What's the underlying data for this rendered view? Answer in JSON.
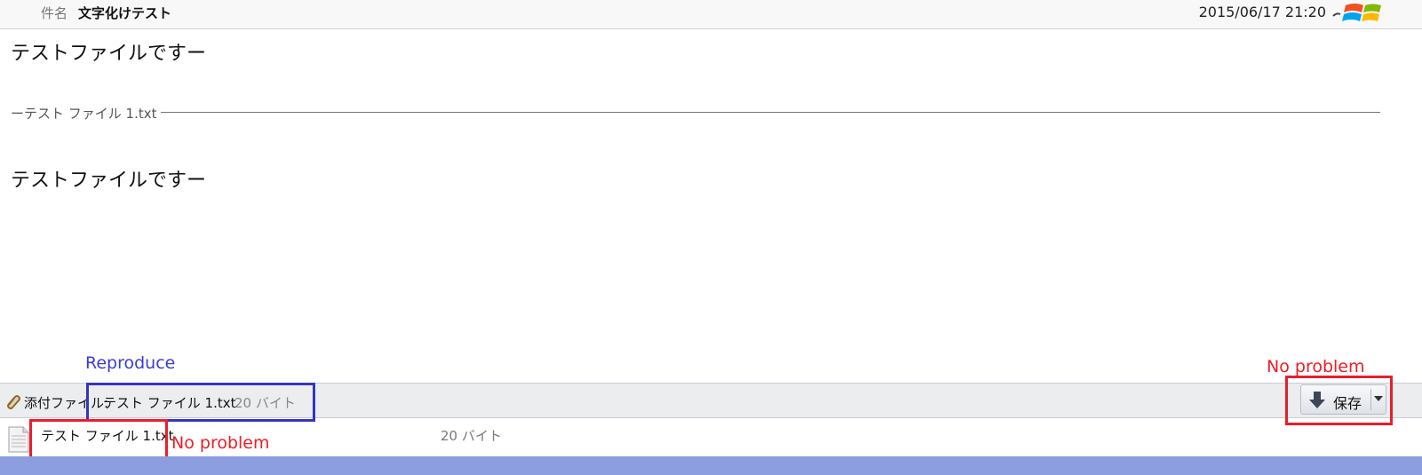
{
  "header": {
    "subject_label": "件名",
    "subject_value": "文字化けテスト",
    "date": "2015/06/17 21:20"
  },
  "body": {
    "text1": "テストファイルですー",
    "divider_label": "ーテスト ファイル 1.txt",
    "text2": "テストファイルですー"
  },
  "attachment_bar": {
    "label": "添付ファイル:",
    "file_name": "テスト ファイル 1.txt",
    "size": "20 バイト",
    "save_label": "保存"
  },
  "file_row": {
    "name": "テスト ファイル 1.txt",
    "size": "20 バイト"
  },
  "annotations": {
    "reproduce": "Reproduce",
    "no_problem_right": "No problem",
    "no_problem_bottom": "No problem"
  },
  "colors": {
    "annotation_blue": "#3434c4",
    "annotation_red": "#ea1d2c",
    "bottom_strip": "#8c9ee0"
  }
}
